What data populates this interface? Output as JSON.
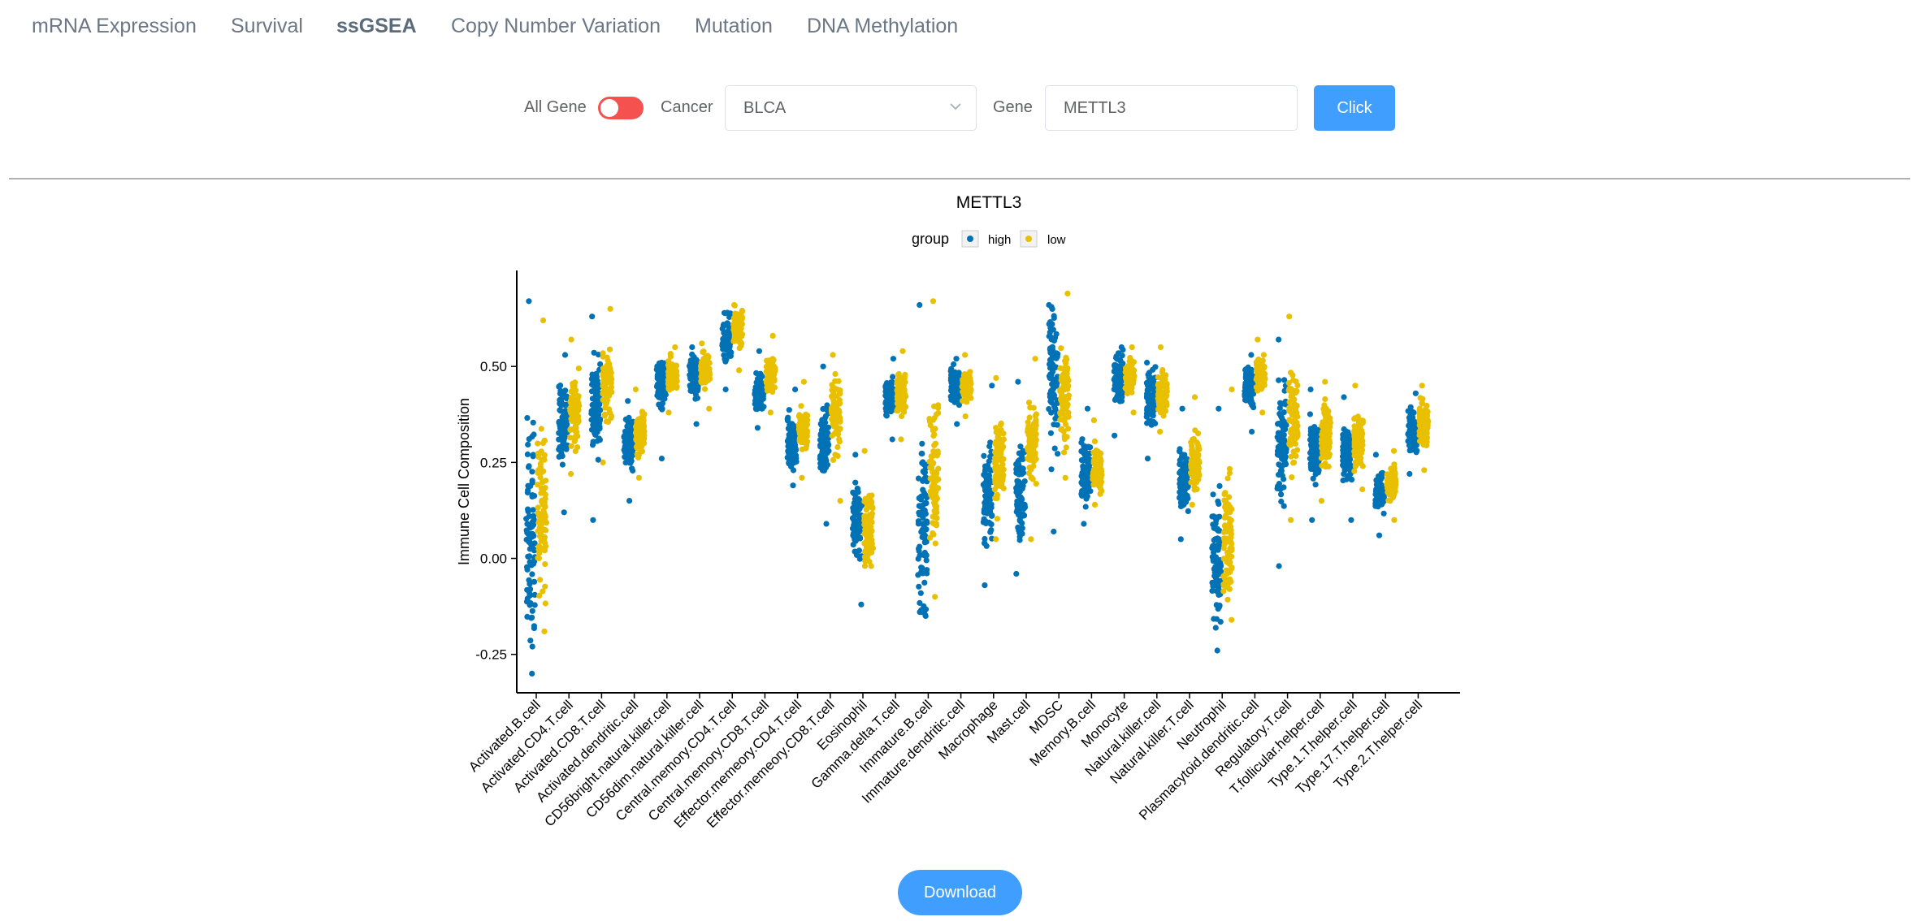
{
  "tabs": [
    {
      "label": "mRNA Expression",
      "active": false
    },
    {
      "label": "Survival",
      "active": false
    },
    {
      "label": "ssGSEA",
      "active": true
    },
    {
      "label": "Copy Number Variation",
      "active": false
    },
    {
      "label": "Mutation",
      "active": false
    },
    {
      "label": "DNA Methylation",
      "active": false
    }
  ],
  "controls": {
    "all_gene_label": "All Gene",
    "all_gene_on": false,
    "cancer_label": "Cancer",
    "cancer_value": "BLCA",
    "gene_label": "Gene",
    "gene_value": "METTL3",
    "submit_label": "Click"
  },
  "download_label": "Download",
  "colors": {
    "high": "#0072b5",
    "low": "#e8c000",
    "toggle": "#f4514f",
    "button": "#409eff",
    "tab_text": "#6b7785"
  },
  "chart_data": {
    "type": "scatter",
    "subtype": "jitter-strip with boxplot",
    "title": "METTL3",
    "legend": {
      "title": "group",
      "entries": [
        "high",
        "low"
      ],
      "position": "top"
    },
    "xlabel": "",
    "ylabel": "Immune Cell Composition",
    "yticks": [
      -0.25,
      0.0,
      0.25,
      0.5
    ],
    "ytick_labels": [
      "-0.25",
      "0.00",
      "0.25",
      "0.50"
    ],
    "ylim": [
      -0.35,
      0.75
    ],
    "categories": [
      "Activated.B.cell",
      "Activated.CD4.T.cell",
      "Activated.CD8.T.cell",
      "Activated.dendritic.cell",
      "CD56bright.natural.killer.cell",
      "CD56dim.natural.killer.cell",
      "Central.memory.CD4.T.cell",
      "Central.memory.CD8.T.cell",
      "Effector.memeory.CD4.T.cell",
      "Effector.memeory.CD8.T.cell",
      "Eosinophil",
      "Gamma.delta.T.cell",
      "Immature.B.cell",
      "Immature.dendritic.cell",
      "Macrophage",
      "Mast.cell",
      "MDSC",
      "Memory.B.cell",
      "Monocyte",
      "Natural.killer.cell",
      "Natural.killer.T.cell",
      "Neutrophil",
      "Plasmacytoid.dendritic.cell",
      "Regulatory.T.cell",
      "T.follicular.helper.cell",
      "Type.1.T.helper.cell",
      "Type.17.T.helper.cell",
      "Type.2.T.helper.cell"
    ],
    "series": [
      {
        "name": "high",
        "median": [
          0.05,
          0.35,
          0.4,
          0.3,
          0.47,
          0.47,
          0.57,
          0.43,
          0.3,
          0.3,
          0.1,
          0.42,
          0.1,
          0.45,
          0.17,
          0.17,
          0.48,
          0.22,
          0.47,
          0.42,
          0.2,
          0.0,
          0.45,
          0.3,
          0.28,
          0.27,
          0.17,
          0.33
        ],
        "min": [
          -0.3,
          0.12,
          0.1,
          0.15,
          0.26,
          0.35,
          0.44,
          0.34,
          0.19,
          0.09,
          -0.12,
          0.31,
          -0.15,
          0.35,
          -0.07,
          -0.04,
          0.07,
          0.09,
          0.32,
          0.26,
          0.05,
          -0.24,
          0.33,
          -0.02,
          0.1,
          0.1,
          0.06,
          0.22
        ],
        "max": [
          0.67,
          0.53,
          0.63,
          0.41,
          0.51,
          0.55,
          0.64,
          0.54,
          0.44,
          0.5,
          0.27,
          0.52,
          0.66,
          0.52,
          0.45,
          0.46,
          0.66,
          0.39,
          0.55,
          0.51,
          0.39,
          0.39,
          0.53,
          0.57,
          0.44,
          0.42,
          0.27,
          0.43
        ]
      },
      {
        "name": "low",
        "median": [
          0.12,
          0.38,
          0.45,
          0.33,
          0.48,
          0.49,
          0.6,
          0.48,
          0.34,
          0.38,
          0.08,
          0.43,
          0.2,
          0.45,
          0.25,
          0.3,
          0.42,
          0.23,
          0.48,
          0.43,
          0.25,
          0.05,
          0.48,
          0.36,
          0.32,
          0.3,
          0.2,
          0.35
        ],
        "min": [
          -0.19,
          0.22,
          0.25,
          0.21,
          0.38,
          0.39,
          0.49,
          0.38,
          0.21,
          0.15,
          -0.02,
          0.31,
          -0.1,
          0.37,
          0.05,
          0.05,
          0.21,
          0.14,
          0.38,
          0.33,
          0.14,
          -0.16,
          0.38,
          0.1,
          0.15,
          0.18,
          0.1,
          0.23
        ],
        "max": [
          0.62,
          0.57,
          0.65,
          0.44,
          0.55,
          0.56,
          0.66,
          0.58,
          0.46,
          0.53,
          0.28,
          0.54,
          0.67,
          0.53,
          0.47,
          0.52,
          0.69,
          0.36,
          0.55,
          0.55,
          0.42,
          0.44,
          0.57,
          0.63,
          0.46,
          0.45,
          0.28,
          0.45
        ]
      }
    ],
    "grid": false
  }
}
